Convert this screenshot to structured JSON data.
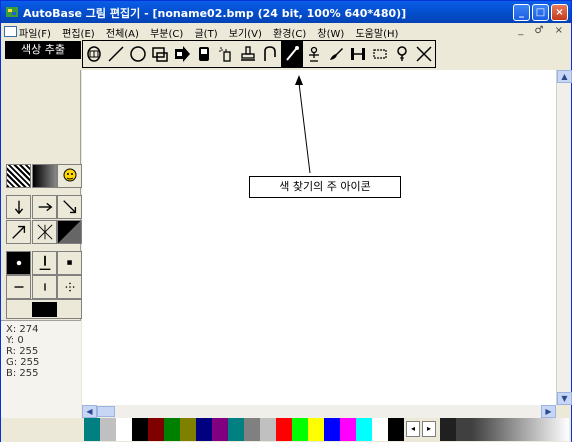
{
  "window": {
    "title": "AutoBase 그림 편집기 - [noname02.bmp (24 bit, 100% 640*480)]",
    "controls": [
      "_",
      "□",
      "×"
    ]
  },
  "menu": {
    "items": [
      "파일(F)",
      "편집(E)",
      "전체(A)",
      "부분(C)",
      "글(T)",
      "보기(V)",
      "환경(C)",
      "창(W)",
      "도움말(H)"
    ],
    "mdi_controls": "_ ♂ ×"
  },
  "toolbar": {
    "label": "색상 추출",
    "tools": [
      "mask-icon",
      "line-icon",
      "circle-icon",
      "rect-fill-icon",
      "arrow-fill-icon",
      "phone-icon",
      "spray-icon",
      "stamp-icon",
      "lasso-icon",
      "eyedropper-icon",
      "person-icon",
      "brush-icon",
      "resize-icon",
      "marquee-icon",
      "magnifier-icon",
      "x-icon"
    ],
    "selected_tool": "eyedropper-icon"
  },
  "left_panel": {
    "coords": [
      "X: 274",
      "Y: 0",
      "R: 255",
      "G: 255",
      "B: 255"
    ]
  },
  "canvas": {
    "callout_text": "색 찾기의 주 아이콘"
  },
  "palette": {
    "colors": [
      "#008080",
      "#c0c0c0",
      "#ffffff",
      "#000000",
      "#800000",
      "#008000",
      "#808000",
      "#000080",
      "#800080",
      "#008080",
      "#808080",
      "#c0c0c0",
      "#ff0000",
      "#00ff00",
      "#ffff00",
      "#0000ff",
      "#ff00ff",
      "#00ffff",
      "#ffffff",
      "#000000",
      "#202020",
      "#404040"
    ]
  }
}
